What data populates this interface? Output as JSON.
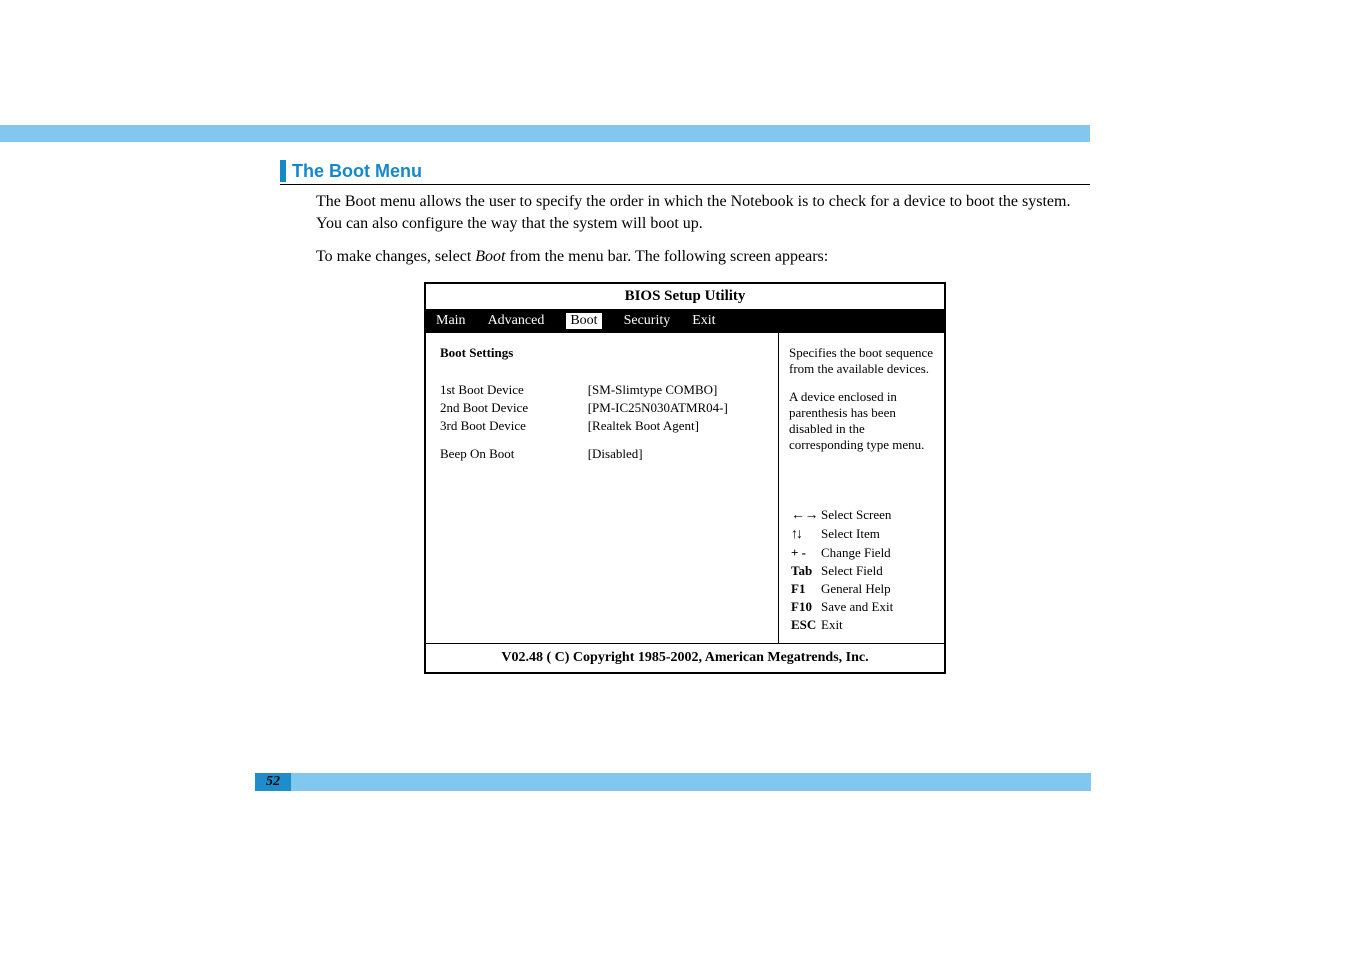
{
  "section_title": "The Boot Menu",
  "paragraph1": "The Boot menu allows the user to specify the order in which the Notebook is to check for a device to boot the system. You can also configure the way that the system will boot up.",
  "paragraph2_pre": "To make changes, select ",
  "paragraph2_em": "Boot",
  "paragraph2_post": " from the menu bar. The following screen appears:",
  "bios": {
    "app_title": "BIOS Setup Utility",
    "tabs": {
      "main": "Main",
      "advanced": "Advanced",
      "boot": "Boot",
      "security": "Security",
      "exit": "Exit"
    },
    "left": {
      "heading": "Boot Settings",
      "rows": [
        {
          "label": "1st Boot Device",
          "value": "[SM-Slimtype COMBO]"
        },
        {
          "label": "2nd Boot Device",
          "value": "[PM-IC25N030ATMR04-]"
        },
        {
          "label": "3rd Boot Device",
          "value": "[Realtek Boot Agent]"
        }
      ],
      "beep_label": "Beep On Boot",
      "beep_value": "[Disabled]"
    },
    "right": {
      "help1": "Specifies the boot sequence from the available devices.",
      "help2": "A device enclosed in parenthesis has been disabled in the corresponding type menu.",
      "keys": [
        {
          "k": "←→",
          "v": "Select Screen",
          "icon": "lr"
        },
        {
          "k": "↑↓",
          "v": "Select Item",
          "icon": "ud"
        },
        {
          "k": "+ -",
          "v": "Change Field",
          "icon": ""
        },
        {
          "k": "Tab",
          "v": "Select Field",
          "icon": ""
        },
        {
          "k": "F1",
          "v": "General Help",
          "icon": ""
        },
        {
          "k": "F10",
          "v": "Save and Exit",
          "icon": ""
        },
        {
          "k": "ESC",
          "v": "Exit",
          "icon": ""
        }
      ]
    },
    "footer": "V02.48  ( C) Copyright 1985-2002, American Megatrends, Inc."
  },
  "page_number": "52"
}
